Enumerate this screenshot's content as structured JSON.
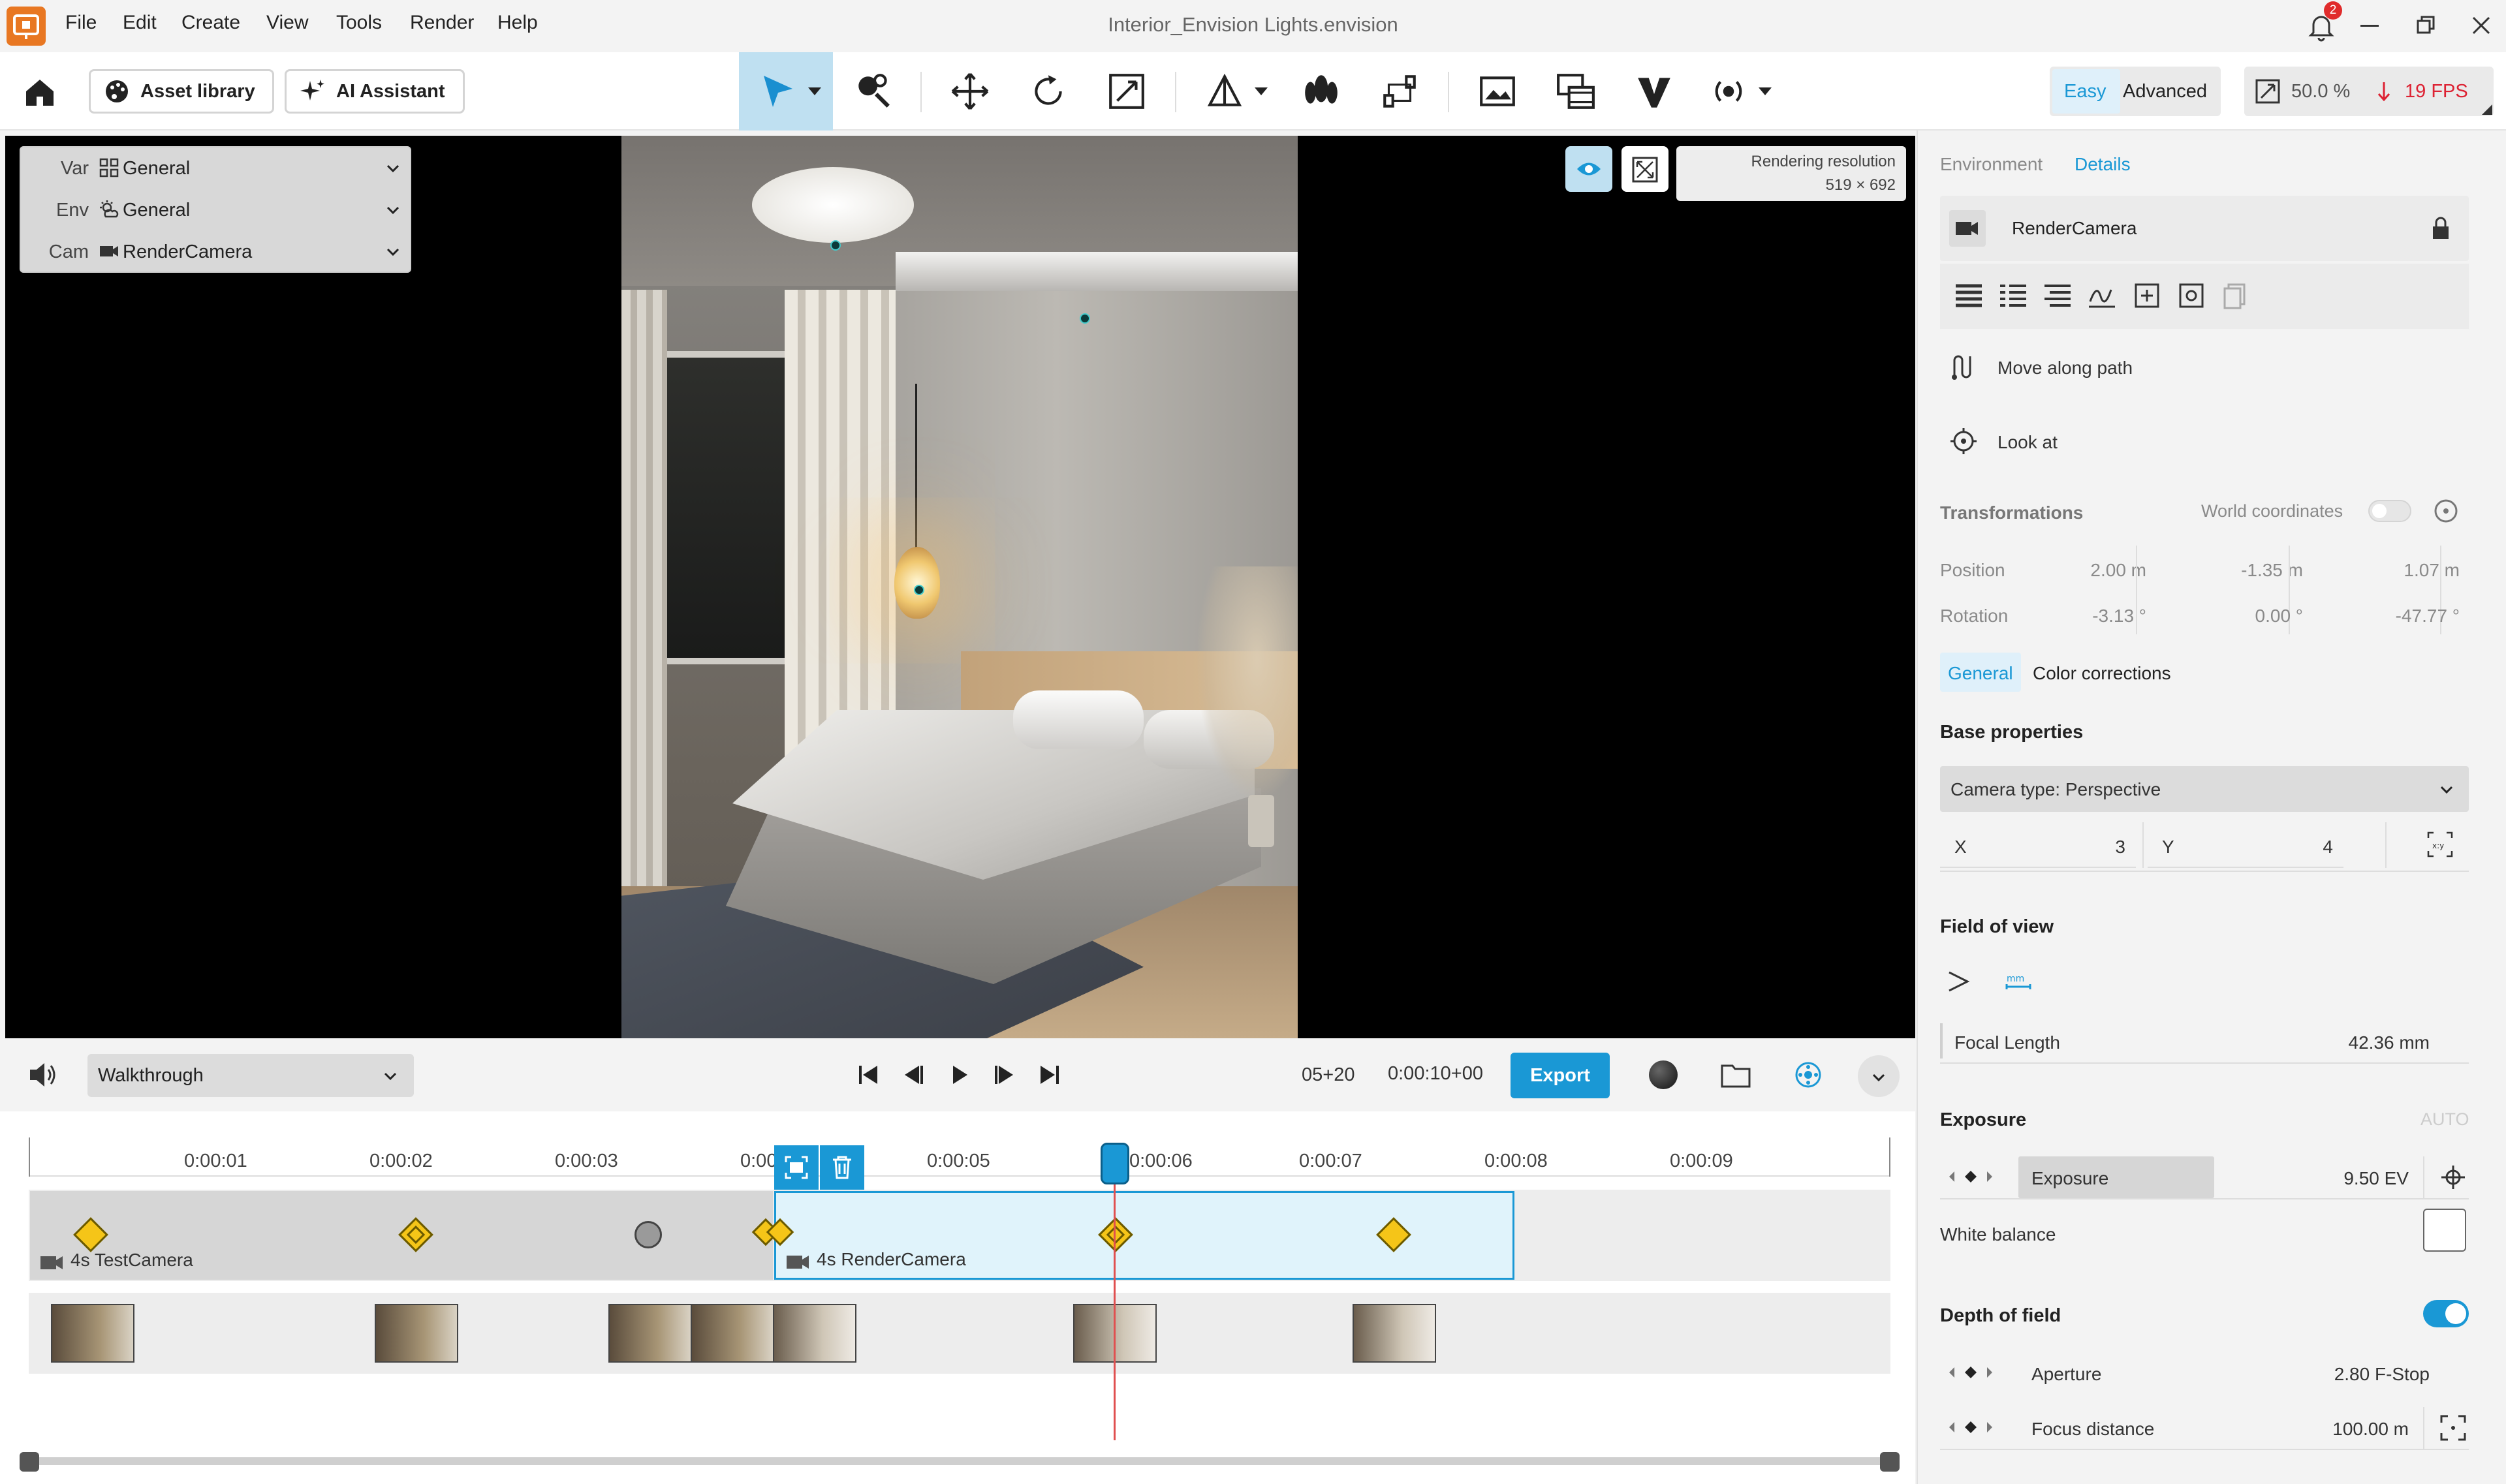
{
  "window": {
    "title": "Interior_Envision Lights.envision",
    "menu": [
      "File",
      "Edit",
      "Create",
      "View",
      "Tools",
      "Render",
      "Help"
    ],
    "notification_count": "2"
  },
  "toolbar": {
    "asset_library": "Asset library",
    "ai_assistant": "AI Assistant",
    "mode_easy": "Easy",
    "mode_advanced": "Advanced",
    "zoom": "50.0 %",
    "fps": "19 FPS"
  },
  "viewport": {
    "render_res_label": "Rendering resolution",
    "render_res_value": "519 × 692",
    "var": {
      "key": "Var",
      "value": "General"
    },
    "env": {
      "key": "Env",
      "value": "General"
    },
    "cam": {
      "key": "Cam",
      "value": "RenderCamera"
    }
  },
  "playback": {
    "animation": "Walkthrough",
    "frame": "05+20",
    "duration": "0:00:10+00",
    "export": "Export"
  },
  "timeline": {
    "ticks": [
      "0:00:01",
      "0:00:02",
      "0:00:03",
      "0:00:04",
      "0:00:05",
      "0:00:06",
      "0:00:07",
      "0:00:08",
      "0:00:09"
    ],
    "clip1": "4s TestCamera",
    "clip2": "4s RenderCamera"
  },
  "panel": {
    "tab_environment": "Environment",
    "tab_details": "Details",
    "object_name": "RenderCamera",
    "move_along_path": "Move along path",
    "look_at": "Look at",
    "transformations": "Transformations",
    "world_coordinates": "World coordinates",
    "position_label": "Position",
    "position": [
      "2.00 m",
      "-1.35 m",
      "1.07 m"
    ],
    "rotation_label": "Rotation",
    "rotation": [
      "-3.13 °",
      "0.00 °",
      "-47.77 °"
    ],
    "subtab_general": "General",
    "subtab_color": "Color corrections",
    "base_properties": "Base properties",
    "camera_type": "Camera type: Perspective",
    "x_label": "X",
    "x_value": "3",
    "y_label": "Y",
    "y_value": "4",
    "fov_title": "Field of view",
    "focal_label": "Focal Length",
    "focal_value": "42.36 mm",
    "exposure_title": "Exposure",
    "exposure_auto": "AUTO",
    "exposure_label": "Exposure",
    "exposure_value": "9.50 EV",
    "white_balance": "White balance",
    "dof_title": "Depth of field",
    "aperture_label": "Aperture",
    "aperture_value": "2.80 F-Stop",
    "focus_label": "Focus distance",
    "focus_value": "100.00 m"
  },
  "colors": {
    "accent": "#1a98d5",
    "keyframe": "#f5c518",
    "playhead": "#e05050"
  }
}
